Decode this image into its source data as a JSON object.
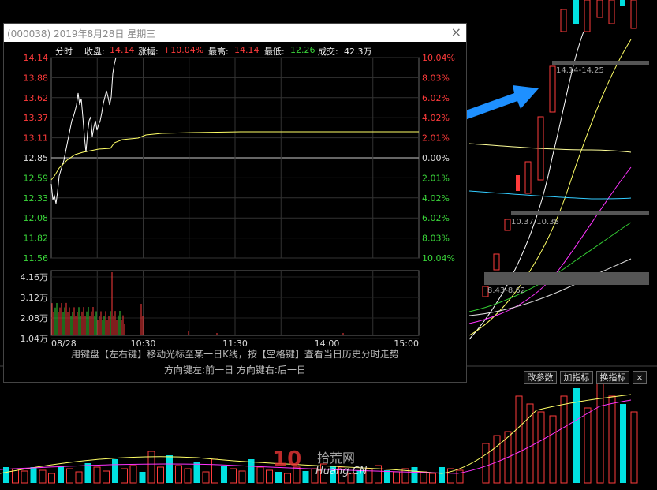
{
  "popup": {
    "title": "(000038) 2019年8月28日 星期三",
    "close_label": "×",
    "info": {
      "mode_label": "分时",
      "close_label": "收盘:",
      "close_value": "14.14",
      "change_label": "涨幅:",
      "change_value": "+10.04%",
      "high_label": "最高:",
      "high_value": "14.14",
      "low_label": "最低:",
      "low_value": "12.26",
      "volume_label": "成交:",
      "volume_value": "42.3万"
    },
    "price_ticks": [
      "14.14",
      "13.88",
      "13.62",
      "13.37",
      "13.11",
      "12.85",
      "12.59",
      "12.33",
      "12.08",
      "11.82",
      "11.56"
    ],
    "pct_ticks": [
      "10.04%",
      "8.03%",
      "6.02%",
      "4.02%",
      "2.01%",
      "0.00%",
      "2.01%",
      "4.02%",
      "6.02%",
      "8.03%",
      "10.04%"
    ],
    "vol_ticks": [
      "4.16万",
      "3.12万",
      "2.08万",
      "1.04万"
    ],
    "time_ticks": [
      "08/28",
      "10:30",
      "11:30",
      "14:00",
      "15:00"
    ],
    "hint_line1": "用键盘【左右键】移动光标至某一日K线，按【空格键】查看当日历史分时走势",
    "hint_line2": "方向键左:前一日   方向键右:后一日"
  },
  "toolbar": {
    "modify_params": "改参数",
    "add_indicator": "加指标",
    "change_indicator": "换指标",
    "close": "×"
  },
  "main_chart": {
    "range_labels": [
      "14.14-14.25",
      "10.37-10.38",
      "8.43-8.62"
    ]
  },
  "watermark": {
    "logo": "10",
    "brand": "拾荒网",
    "domain": "Huang.CN"
  },
  "colors": {
    "up": "#ff3b3b",
    "down": "#00e0e0",
    "green_text": "#3ad53a",
    "ma_yellow": "#ffff66",
    "ma_white": "#ffffff",
    "ma_magenta": "#ff33ff",
    "ma_green": "#33cc33",
    "arrow": "#1e90ff"
  }
}
